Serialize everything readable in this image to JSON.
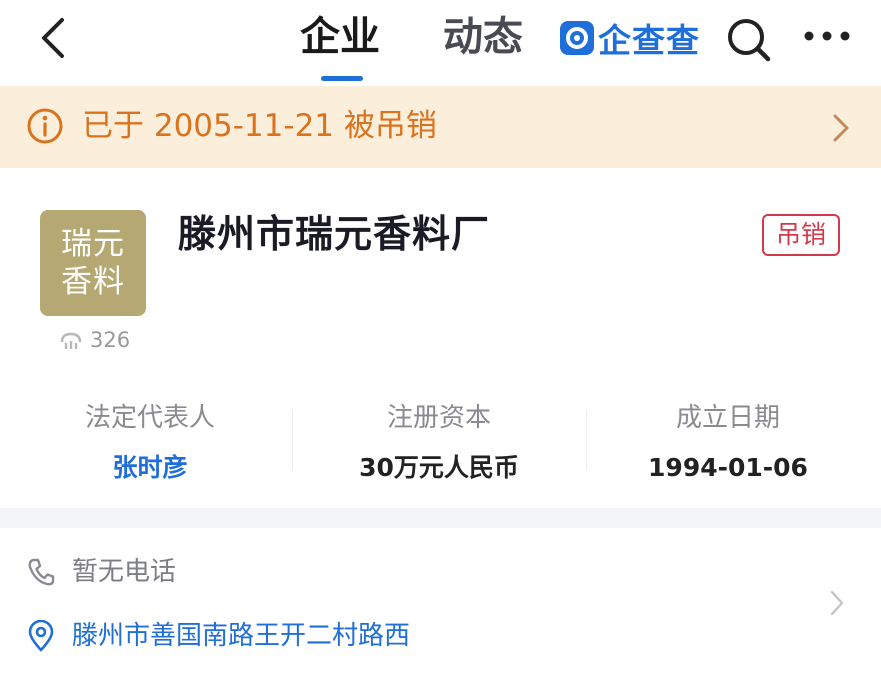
{
  "header": {
    "tabs": [
      {
        "label": "企业",
        "active": true
      },
      {
        "label": "动态",
        "active": false
      }
    ],
    "brand": "企查查",
    "accent_color": "#1f6fd9"
  },
  "banner": {
    "text": "已于 2005-11-21 被吊销",
    "color": "#d9731e"
  },
  "company": {
    "logo_line1": "瑞元",
    "logo_line2": "香料",
    "views": "326",
    "name": "滕州市瑞元香料厂",
    "status": "吊销",
    "status_color": "#d23a4c"
  },
  "info": [
    {
      "label": "法定代表人",
      "value": "张时彦"
    },
    {
      "label": "注册资本",
      "value": "30万元人民币"
    },
    {
      "label": "成立日期",
      "value": "1994-01-06"
    }
  ],
  "contact": {
    "phone": "暂无电话",
    "address": "滕州市善国南路王开二村路西"
  }
}
